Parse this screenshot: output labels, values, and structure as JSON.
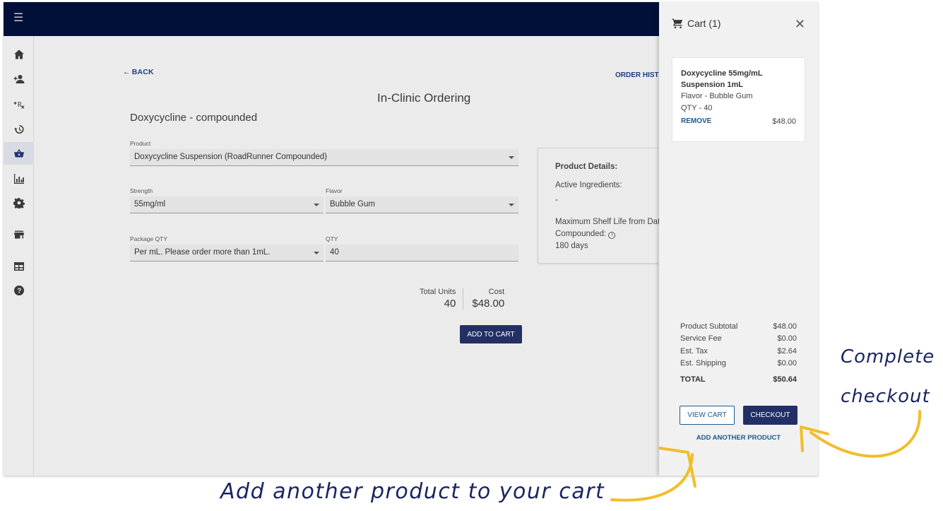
{
  "sidebar": {
    "items": [
      {
        "name": "home-icon"
      },
      {
        "name": "add-user-icon"
      },
      {
        "name": "add-prescription-icon"
      },
      {
        "name": "history-icon"
      },
      {
        "name": "basket-icon"
      },
      {
        "name": "chart-icon"
      },
      {
        "name": "gear-icon"
      },
      {
        "name": "store-icon"
      },
      {
        "name": "table-icon"
      },
      {
        "name": "help-icon"
      }
    ]
  },
  "header": {
    "menu_icon": "menu-icon"
  },
  "main": {
    "back_label": "BACK",
    "order_history_label": "ORDER HISTO",
    "page_title": "In-Clinic Ordering",
    "drug_title": "Doxycycline - compounded",
    "product": {
      "label": "Product",
      "value": "Doxycycline Suspension (RoadRunner Compounded)"
    },
    "strength": {
      "label": "Strength",
      "value": "55mg/ml"
    },
    "flavor": {
      "label": "Flavor",
      "value": "Bubble Gum"
    },
    "package_qty": {
      "label": "Package QTY",
      "value": "Per mL. Please order more than 1mL."
    },
    "qty": {
      "label": "QTY",
      "value": "40"
    },
    "total_units_label": "Total Units",
    "total_units_value": "40",
    "cost_label": "Cost",
    "cost_value": "$48.00",
    "add_to_cart_label": "ADD TO CART"
  },
  "details": {
    "heading": "Product Details:",
    "active_ingredients_label": "Active Ingredients:",
    "active_ingredients_value": "-",
    "shelf_life_label_1": "Maximum Shelf Life from Date",
    "shelf_life_label_2": "Compounded:",
    "shelf_life_value": "180 days"
  },
  "cart": {
    "title": "Cart (1)",
    "item": {
      "name_line1": "Doxycycline 55mg/mL",
      "name_line2": "Suspension 1mL",
      "flavor": "Flavor - Bubble Gum",
      "qty": "QTY - 40",
      "remove_label": "REMOVE",
      "price": "$48.00"
    },
    "totals": {
      "subtotal_label": "Product Subtotal",
      "subtotal_value": "$48.00",
      "service_label": "Service Fee",
      "service_value": "$0.00",
      "tax_label": "Est. Tax",
      "tax_value": "$2.64",
      "shipping_label": "Est. Shipping",
      "shipping_value": "$0.00",
      "total_label": "TOTAL",
      "total_value": "$50.64"
    },
    "view_cart_label": "VIEW CART",
    "checkout_label": "CHECKOUT",
    "add_another_label": "ADD ANOTHER PRODUCT"
  },
  "annotations": {
    "complete_line1": "Complete",
    "complete_line2": "checkout",
    "add_another": "Add another product to your cart"
  },
  "colors": {
    "topbar": "#001038",
    "primary_button": "#233066",
    "link": "#1a5a8c",
    "annotation_arrow": "#f2bd2c",
    "annotation_text": "#1a2560"
  }
}
